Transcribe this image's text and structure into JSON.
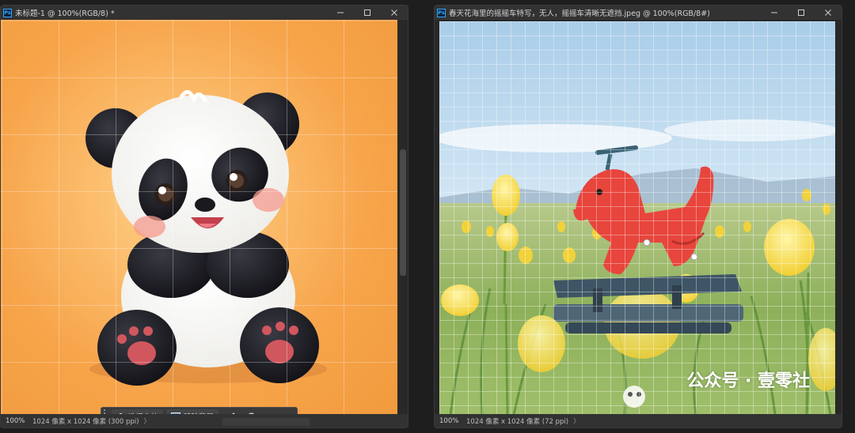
{
  "left_window": {
    "title": "未标题-1 @ 100%(RGB/8) *",
    "zoom": "100%",
    "doc_info": "1024 像素 x 1024 像素 (300 ppi)",
    "chevron": "〉",
    "contextual_bar": {
      "select_subject_label": "选择主体",
      "remove_background_label": "移除背景",
      "more_label": "•••"
    }
  },
  "right_window": {
    "title": "春天花海里的摇摇车特写，无人，摇摇车清晰无遮挡.jpeg @ 100%(RGB/8#)",
    "zoom": "100%",
    "doc_info": "1024 像素 x 1024 像素 (72 ppi)",
    "chevron": "〉"
  },
  "window_controls": {
    "minimize": "—",
    "maximize": "☐",
    "close": "✕"
  },
  "ps_badge": "Ps",
  "watermark": {
    "text": "公众号 · 壹零社"
  },
  "colors": {
    "accent": "#31a8ff",
    "chrome": "#323232",
    "panda_bg": "#f7a44a",
    "rocking_horse": "#e8453c",
    "tulip": "#f5d63a"
  }
}
